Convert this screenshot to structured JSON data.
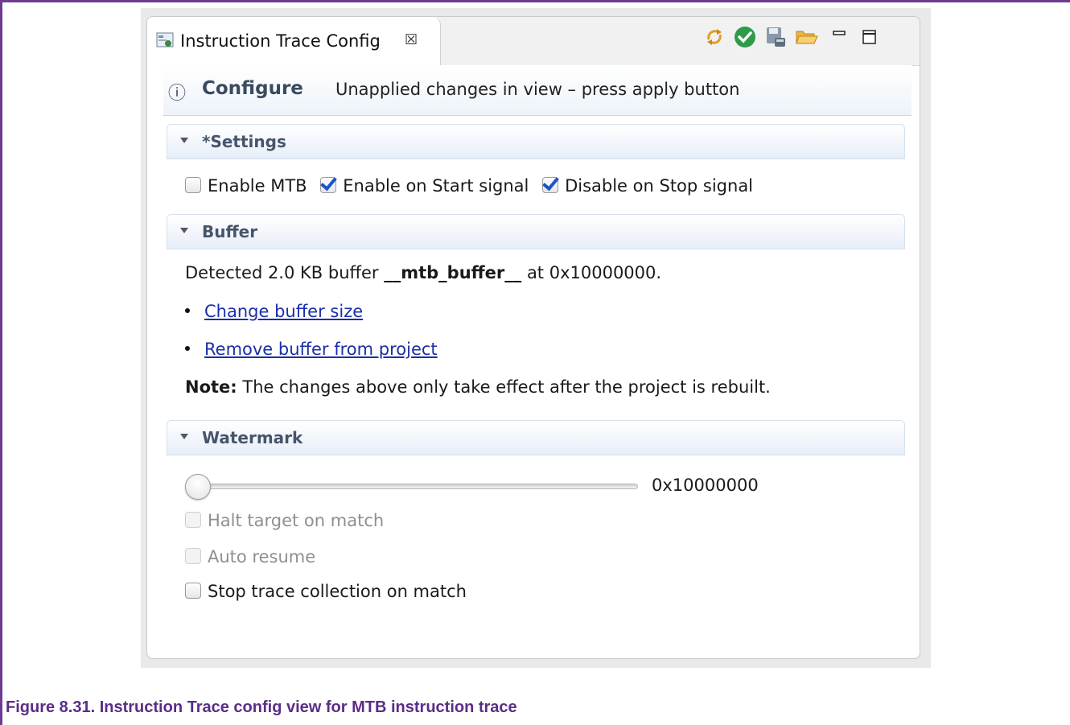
{
  "tab": {
    "title": "Instruction Trace Config",
    "close_glyph": "☒"
  },
  "toolbar": {
    "icons": [
      "sync-icon",
      "apply-check-icon",
      "save-icon",
      "open-folder-icon",
      "minimize-icon",
      "maximize-icon"
    ]
  },
  "header": {
    "info_glyph": "ⓘ",
    "title": "Configure",
    "status": "Unapplied changes in view – press apply button"
  },
  "settings": {
    "title": "*Settings",
    "checkboxes": [
      {
        "label": "Enable MTB",
        "checked": false
      },
      {
        "label": "Enable on Start signal",
        "checked": true
      },
      {
        "label": "Disable on Stop signal",
        "checked": true
      }
    ]
  },
  "buffer": {
    "title": "Buffer",
    "detected_prefix": "Detected 2.0 KB buffer ",
    "buffer_name": "__mtb_buffer__",
    "detected_suffix": " at 0x10000000.",
    "links": [
      "Change buffer size",
      "Remove buffer from project"
    ],
    "note_label": "Note:",
    "note_text": " The changes above only take effect after the project is rebuilt."
  },
  "watermark": {
    "title": "Watermark",
    "slider_value": "0x10000000",
    "slider_position": 0,
    "checkboxes": [
      {
        "label": "Halt target on match",
        "checked": false,
        "disabled": true
      },
      {
        "label": "Auto resume",
        "checked": false,
        "disabled": true
      },
      {
        "label": "Stop trace collection on match",
        "checked": false,
        "disabled": false
      }
    ]
  },
  "caption": "Figure 8.31. Instruction Trace config view for MTB instruction trace",
  "colors": {
    "frame": "#6e3b92",
    "caption": "#5b2d86",
    "link": "#1a2fa6",
    "check": "#1d55c4"
  }
}
